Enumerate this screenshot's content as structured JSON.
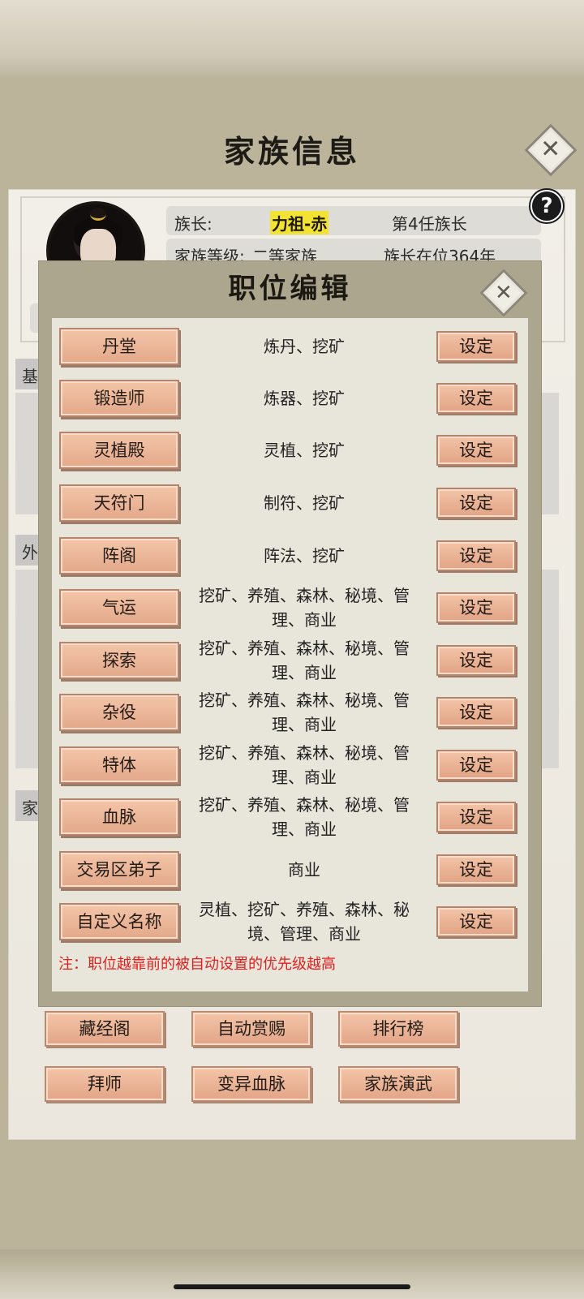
{
  "page": {
    "title": "家族信息",
    "close_icon": "✕"
  },
  "clan": {
    "leader_label": "族长:",
    "leader_name": "力祖-赤",
    "leader_order": "第4任族长",
    "level_label": "家族等级:",
    "level_value": "二等家族",
    "tenure": "族长在位364年",
    "help_icon": "?"
  },
  "sections": {
    "basic_tab": "基",
    "outer_tab": "外",
    "clan_tab": "家"
  },
  "bottom_buttons": [
    {
      "label": "藏经阁"
    },
    {
      "label": "自动赏赐"
    },
    {
      "label": "排行榜"
    },
    {
      "label": "拜师"
    },
    {
      "label": "变异血脉"
    },
    {
      "label": "家族演武"
    }
  ],
  "modal": {
    "title": "职位编辑",
    "close_icon": "✕",
    "set_label": "设定",
    "note": "注：职位越靠前的被自动设置的优先级越高",
    "positions": [
      {
        "name": "丹堂",
        "duties": "炼丹、挖矿"
      },
      {
        "name": "锻造师",
        "duties": "炼器、挖矿"
      },
      {
        "name": "灵植殿",
        "duties": "灵植、挖矿"
      },
      {
        "name": "天符门",
        "duties": "制符、挖矿"
      },
      {
        "name": "阵阁",
        "duties": "阵法、挖矿"
      },
      {
        "name": "气运",
        "duties": "挖矿、养殖、森林、秘境、管理、商业"
      },
      {
        "name": "探索",
        "duties": "挖矿、养殖、森林、秘境、管理、商业"
      },
      {
        "name": "杂役",
        "duties": "挖矿、养殖、森林、秘境、管理、商业"
      },
      {
        "name": "特体",
        "duties": "挖矿、养殖、森林、秘境、管理、商业"
      },
      {
        "name": "血脉",
        "duties": "挖矿、养殖、森林、秘境、管理、商业"
      },
      {
        "name": "交易区弟子",
        "duties": "商业"
      },
      {
        "name": "自定义名称",
        "duties": "灵植、挖矿、养殖、森林、秘境、管理、商业"
      }
    ]
  }
}
